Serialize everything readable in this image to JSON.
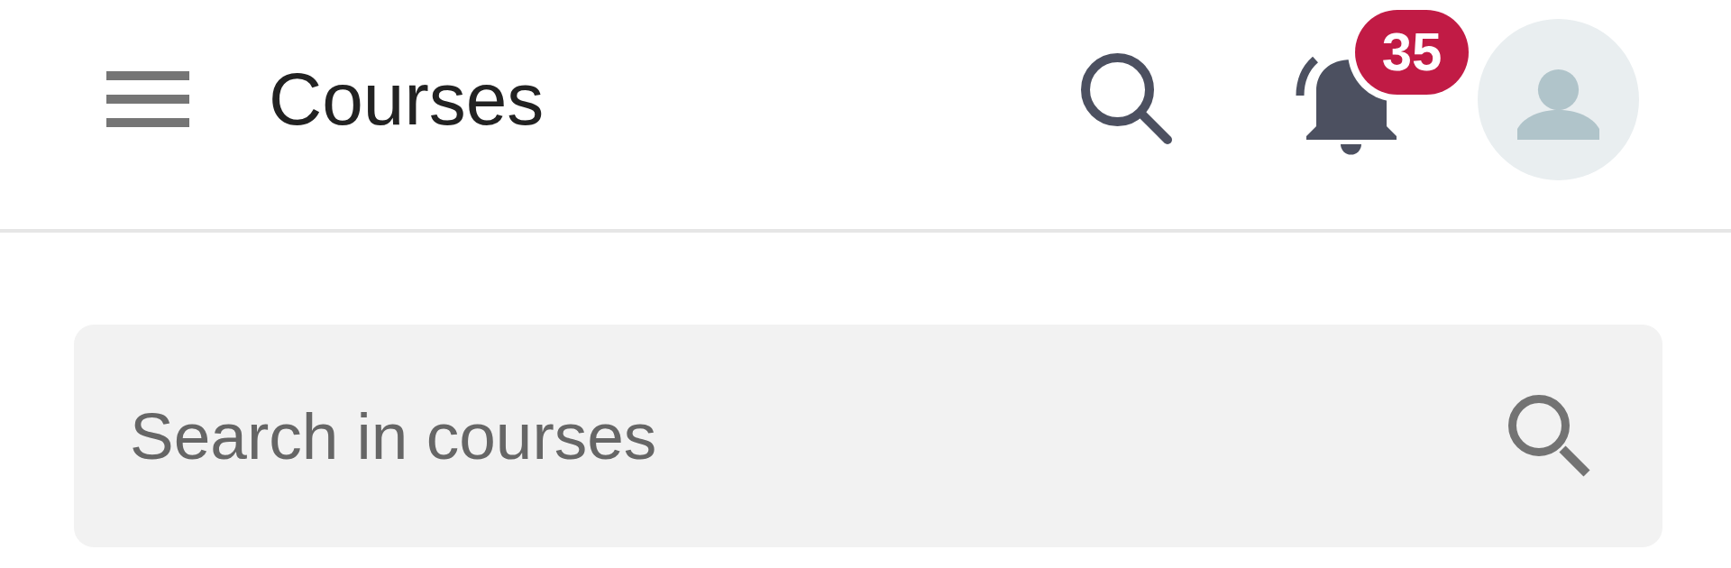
{
  "header": {
    "title": "Courses",
    "notifications": {
      "count": "35"
    }
  },
  "search": {
    "placeholder": "Search in courses"
  }
}
